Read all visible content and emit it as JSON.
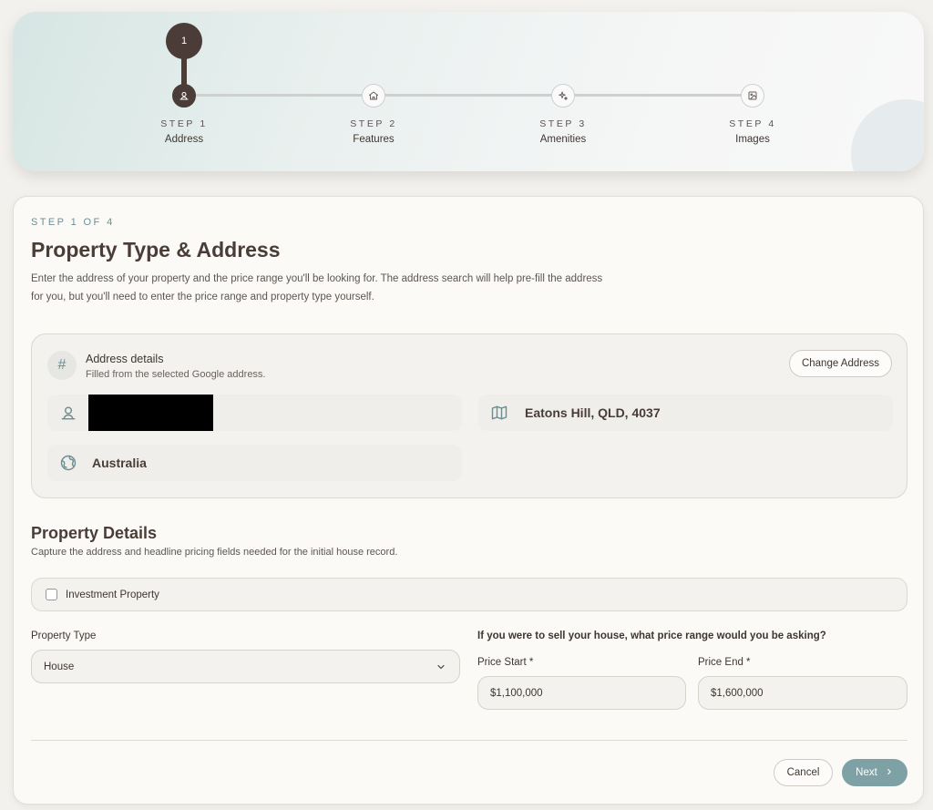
{
  "stepper": {
    "current_number": "1",
    "steps": [
      {
        "num": "STEP 1",
        "label": "Address",
        "icon": "location-pin-icon"
      },
      {
        "num": "STEP 2",
        "label": "Features",
        "icon": "home-icon"
      },
      {
        "num": "STEP 3",
        "label": "Amenities",
        "icon": "sparkles-icon"
      },
      {
        "num": "STEP 4",
        "label": "Images",
        "icon": "image-icon"
      }
    ]
  },
  "form": {
    "eyebrow": "STEP 1 OF 4",
    "title": "Property Type & Address",
    "description": "Enter the address of your property and the price range you'll be looking for. The address search will help pre-fill the address for you, but you'll need to enter the price range and property type yourself."
  },
  "address": {
    "title": "Address details",
    "subtitle": "Filled from the selected Google address.",
    "change_label": "Change Address",
    "suburb": "Eatons Hill, QLD, 4037",
    "country": "Australia"
  },
  "details": {
    "title": "Property Details",
    "subtitle": "Capture the address and headline pricing fields needed for the initial house record.",
    "investment_label": "Investment Property",
    "investment_checked": false,
    "property_type_label": "Property Type",
    "property_type_value": "House",
    "price_question": "If you were to sell your house, what price range would you be asking?",
    "price_start_label": "Price Start *",
    "price_start_value": "$1,100,000",
    "price_end_label": "Price End *",
    "price_end_value": "$1,600,000"
  },
  "footer": {
    "cancel_label": "Cancel",
    "next_label": "Next"
  },
  "colors": {
    "primary_dark": "#4b3c37",
    "accent_teal": "#7ea1a6"
  }
}
